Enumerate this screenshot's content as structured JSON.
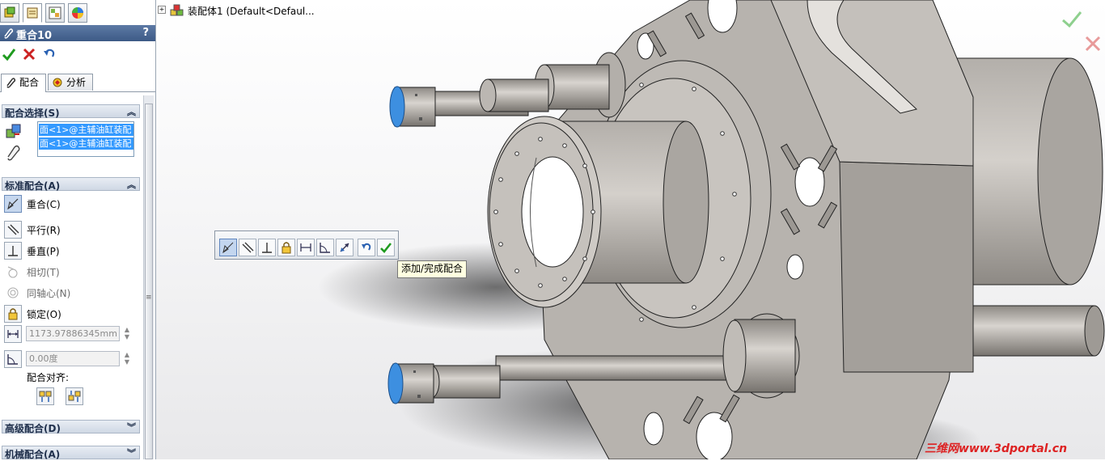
{
  "panel": {
    "title": "重合10",
    "help": "?",
    "tabs": [
      "feature-manager",
      "property-manager",
      "configuration-manager",
      "appearance-manager"
    ],
    "subtabs": {
      "mates": "配合",
      "analysis": "分析"
    },
    "selection_group": {
      "title": "配合选择(S)",
      "items": [
        "面<1>@主辅油缸装配",
        "面<1>@主辅油缸装配"
      ]
    },
    "standard_group": {
      "title": "标准配合(A)",
      "coincident": "重合(C)",
      "parallel": "平行(R)",
      "perpendicular": "垂直(P)",
      "tangent": "相切(T)",
      "concentric": "同轴心(N)",
      "lock": "锁定(O)",
      "distance_value": "1173.97886345mm",
      "angle_value": "0.00度",
      "alignment_label": "配合对齐:"
    },
    "advanced_group": {
      "title": "高级配合(D)"
    },
    "mechanical_group": {
      "title": "机械配合(A)"
    }
  },
  "viewport": {
    "tree_text": "装配体1  (Default<Defaul...",
    "tooltip": "添加/完成配合",
    "watermark": "三维网www.3dportal.cn"
  },
  "colors": {
    "accent": "#3d5a86",
    "ok": "#1f9b1f",
    "cancel": "#cc2222",
    "selected_face": "#3d8fe0"
  }
}
